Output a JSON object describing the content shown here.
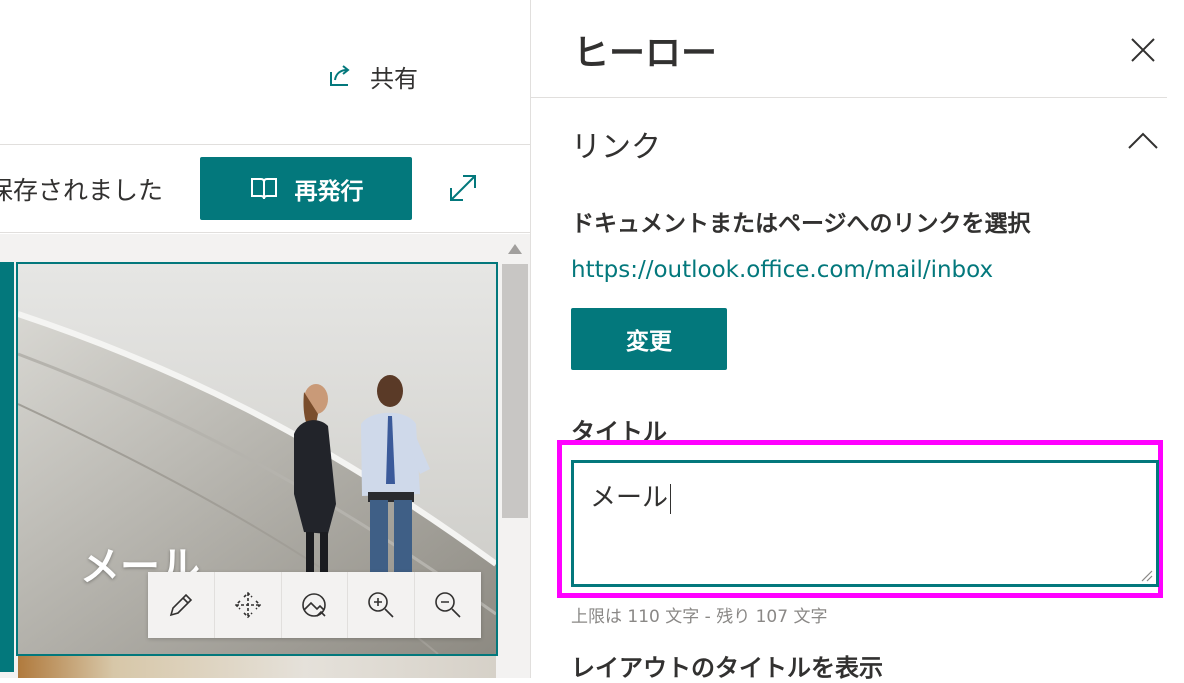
{
  "header": {
    "share_label": "共有"
  },
  "toolbar": {
    "saved_status": "保存されました",
    "republish_label": "再発行"
  },
  "hero_tile": {
    "title": "メール"
  },
  "image_toolbar": {
    "buttons": [
      "edit-icon",
      "move-icon",
      "focal-point-icon",
      "zoom-in-icon",
      "zoom-out-icon"
    ]
  },
  "pane": {
    "title": "ヒーロー",
    "section_title": "リンク",
    "link_label": "ドキュメントまたはページへのリンクを選択",
    "link_url": "https://outlook.office.com/mail/inbox",
    "change_button": "変更",
    "title_label": "タイトル",
    "title_value": "メール",
    "char_counter": "上限は 110 文字 - 残り 107 文字",
    "layout_label": "レイアウトのタイトルを表示"
  },
  "colors": {
    "accent": "#03787c",
    "highlight": "#ff00ff",
    "text": "#323130",
    "muted": "#8a8886"
  }
}
